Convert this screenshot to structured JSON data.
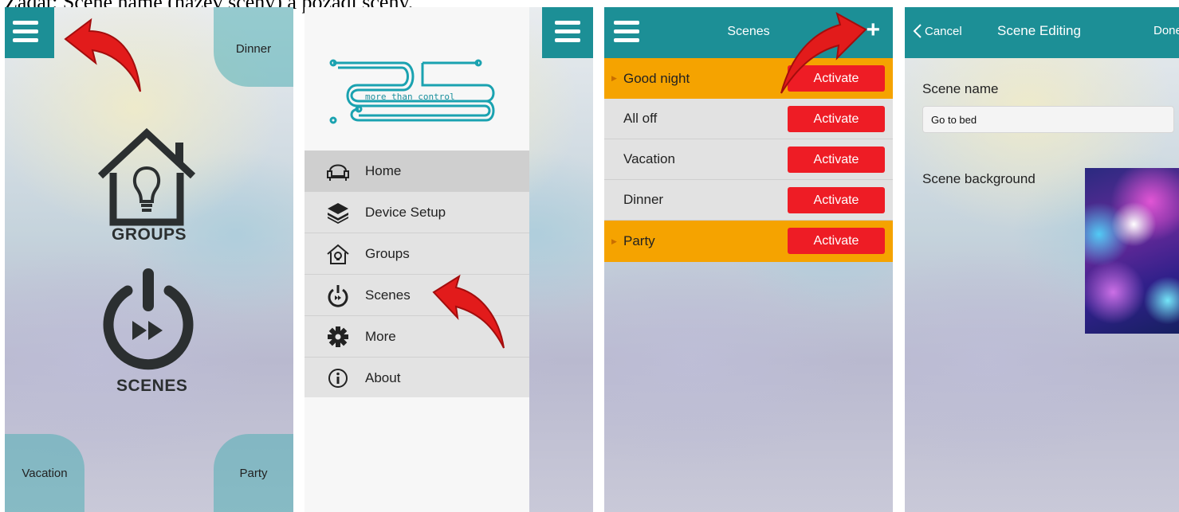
{
  "caption": "Zadat: Scene name (název scény) a pozadí scény.",
  "home": {
    "tiles": {
      "dinner": "Dinner",
      "vacation": "Vacation",
      "party": "Party"
    },
    "groups_label": "GROUPS",
    "scenes_label": "SCENES"
  },
  "menu": {
    "logo_text": "more than control",
    "items": [
      {
        "label": "Home",
        "icon": "sofa-icon"
      },
      {
        "label": "Device Setup",
        "icon": "layers-icon"
      },
      {
        "label": "Groups",
        "icon": "house-bulb-icon"
      },
      {
        "label": "Scenes",
        "icon": "power-play-icon"
      },
      {
        "label": "More",
        "icon": "gear-icon"
      },
      {
        "label": "About",
        "icon": "info-icon"
      }
    ],
    "selected": "Home"
  },
  "scenes": {
    "title": "Scenes",
    "add_label": "+",
    "rows": [
      {
        "name": "Good night",
        "button": "Activate",
        "highlighted": true
      },
      {
        "name": "All off",
        "button": "Activate",
        "highlighted": false
      },
      {
        "name": "Vacation",
        "button": "Activate",
        "highlighted": false
      },
      {
        "name": "Dinner",
        "button": "Activate",
        "highlighted": false
      },
      {
        "name": "Party",
        "button": "Activate",
        "highlighted": true
      }
    ]
  },
  "editing": {
    "cancel_label": "Cancel",
    "title": "Scene Editing",
    "done_label": "Done",
    "name_label": "Scene name",
    "name_value": "Go to bed",
    "background_label": "Scene background"
  },
  "colors": {
    "teal": "#1c8f96",
    "orange": "#f5a300",
    "activate_red": "#ee1c25",
    "arrow_red": "#e21b1b"
  }
}
